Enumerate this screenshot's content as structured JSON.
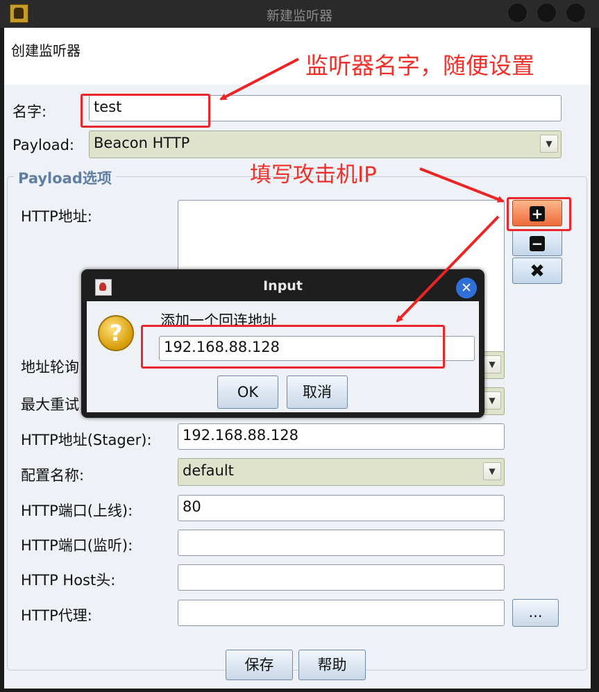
{
  "window": {
    "title": "新建监听器",
    "header": "创建监听器"
  },
  "form": {
    "name_label": "名字:",
    "name_value": "test",
    "payload_label": "Payload:",
    "payload_value": "Beacon HTTP",
    "group_title": "Payload选项",
    "http_hosts_label": "HTTP地址:",
    "rotate_label": "地址轮询",
    "max_retry_label": "最大重试",
    "stager_label": "HTTP地址(Stager):",
    "stager_value": "192.168.88.128",
    "profile_label": "配置名称:",
    "profile_value": "default",
    "port_label": "HTTP端口(上线):",
    "port_value": "80",
    "bind_port_label": "HTTP端口(监听):",
    "bind_port_value": "",
    "host_header_label": "HTTP Host头:",
    "host_header_value": "",
    "proxy_label": "HTTP代理:",
    "proxy_value": "",
    "proxy_button": "...",
    "save_button": "保存",
    "help_button": "帮助"
  },
  "side_buttons": {
    "add_icon": "plus-icon",
    "remove_icon": "minus-icon",
    "clear_icon": "x-icon",
    "add_symbol": "+",
    "remove_symbol": "−",
    "clear_symbol": "✖"
  },
  "dialog": {
    "title": "Input",
    "message": "添加一个回连地址",
    "value": "192.168.88.128",
    "ok": "OK",
    "cancel": "取消",
    "close_symbol": "✕",
    "question_symbol": "?"
  },
  "annotations": {
    "name_note": "监听器名字，随便设置",
    "ip_note": "填写攻击机IP"
  },
  "colors": {
    "annotation": "#e8262b",
    "add_button": "#ef6a3a",
    "group_title": "#5f7ea0"
  }
}
